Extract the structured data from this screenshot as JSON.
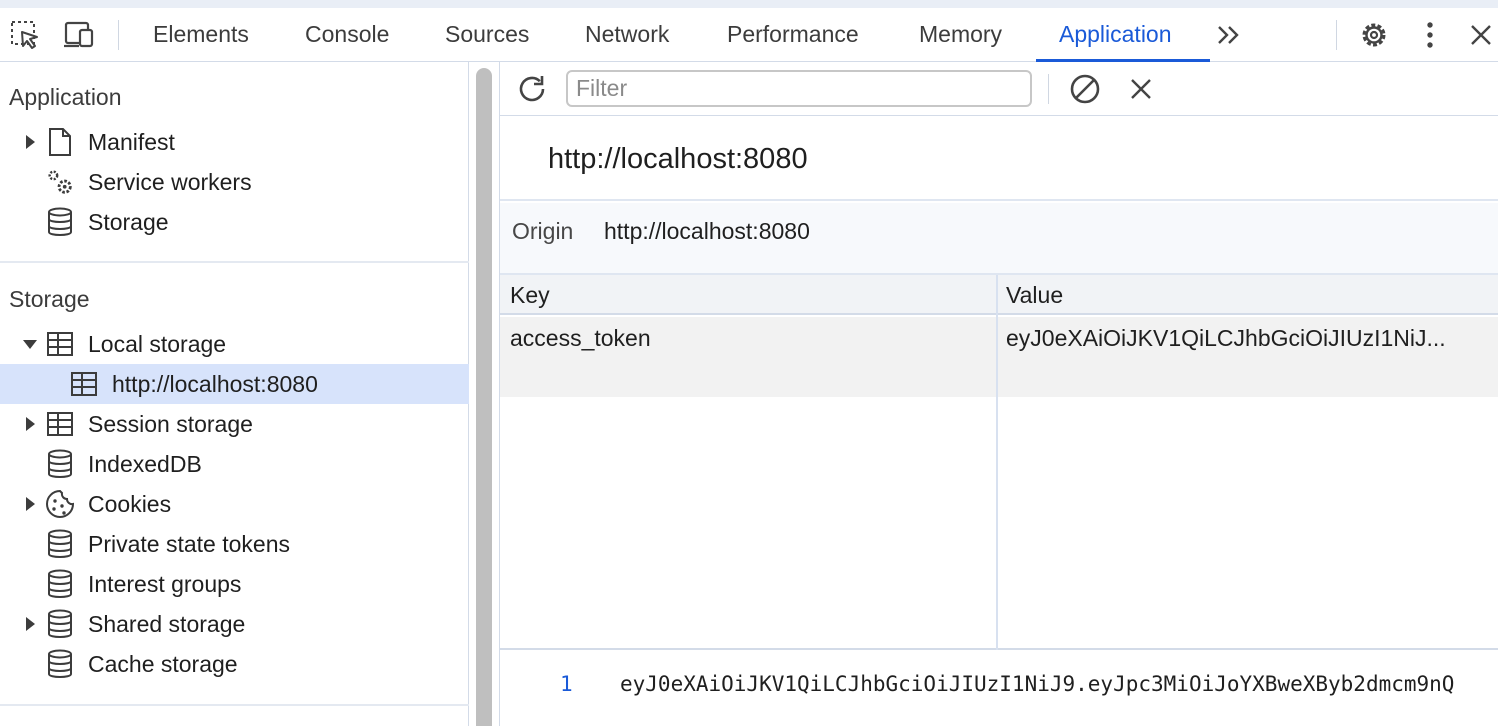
{
  "toolbar": {
    "inspect_icon": "inspect-element-icon",
    "device_icon": "device-toolbar-icon",
    "tabs": [
      {
        "label": "Elements",
        "active": false
      },
      {
        "label": "Console",
        "active": false
      },
      {
        "label": "Sources",
        "active": false
      },
      {
        "label": "Network",
        "active": false
      },
      {
        "label": "Performance",
        "active": false
      },
      {
        "label": "Memory",
        "active": false
      },
      {
        "label": "Application",
        "active": true
      }
    ],
    "more_tabs_icon": "chevron-double-right-icon",
    "settings_icon": "gear-icon",
    "menu_icon": "kebab-menu-icon",
    "close_icon": "close-icon",
    "accent_color": "#1a5ad8"
  },
  "sidebar": {
    "application_section": {
      "title": "Application",
      "items": [
        {
          "label": "Manifest",
          "icon": "file-icon",
          "expandable": true
        },
        {
          "label": "Service workers",
          "icon": "gears-icon",
          "expandable": false
        },
        {
          "label": "Storage",
          "icon": "database-icon",
          "expandable": false
        }
      ]
    },
    "storage_section": {
      "title": "Storage",
      "items": [
        {
          "label": "Local storage",
          "icon": "table-icon",
          "expandable": true,
          "expanded": true
        },
        {
          "label": "http://localhost:8080",
          "icon": "table-icon",
          "selected": true,
          "child": true
        },
        {
          "label": "Session storage",
          "icon": "table-icon",
          "expandable": true
        },
        {
          "label": "IndexedDB",
          "icon": "database-icon",
          "expandable": false
        },
        {
          "label": "Cookies",
          "icon": "cookie-icon",
          "expandable": true
        },
        {
          "label": "Private state tokens",
          "icon": "database-icon",
          "expandable": false
        },
        {
          "label": "Interest groups",
          "icon": "database-icon",
          "expandable": false
        },
        {
          "label": "Shared storage",
          "icon": "database-icon",
          "expandable": true
        },
        {
          "label": "Cache storage",
          "icon": "database-icon",
          "expandable": false
        }
      ]
    }
  },
  "main": {
    "filter": {
      "placeholder": "Filter",
      "value": ""
    },
    "refresh_icon": "refresh-icon",
    "clear_all_icon": "block-icon",
    "delete_icon": "close-icon",
    "origin_title": "http://localhost:8080",
    "origin_label": "Origin",
    "origin_value": "http://localhost:8080",
    "columns": [
      "Key",
      "Value"
    ],
    "rows": [
      {
        "key": "access_token",
        "value": "eyJ0eXAiOiJKV1QiLCJhbGciOiJIUzI1NiJ..."
      }
    ],
    "preview": {
      "line_number": "1",
      "text": "eyJ0eXAiOiJKV1QiLCJhbGciOiJIUzI1NiJ9.eyJpc3MiOiJoYXBweXByb2dmcm9nQ"
    }
  }
}
